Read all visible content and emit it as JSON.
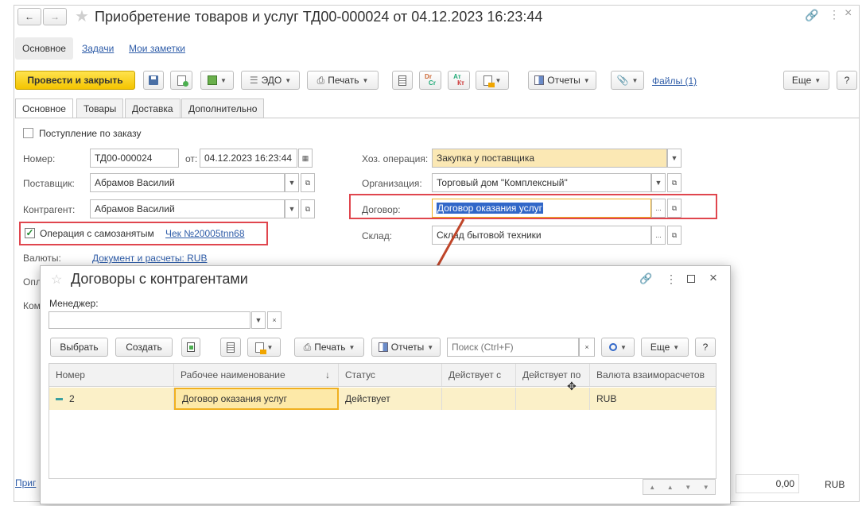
{
  "window": {
    "title": "Приобретение товаров и услуг ТД00-000024 от 04.12.2023 16:23:44",
    "more_glyph": "⋮",
    "close_glyph": "×"
  },
  "top_tabs": [
    "Основное",
    "Задачи",
    "Мои заметки"
  ],
  "toolbar": {
    "post_close": "Провести и закрыть",
    "edo": "ЭДО",
    "print": "Печать",
    "reports": "Отчеты",
    "files": "Файлы (1)",
    "more": "Еще",
    "help": "?",
    "dt_kt_top": "Dr",
    "dt_kt_bottom": "Cr",
    "at_top": "Ат",
    "at_bottom": "Кт"
  },
  "form_tabs": [
    "Основное",
    "Товары",
    "Доставка",
    "Дополнительно"
  ],
  "form": {
    "by_order_label": "Поступление по заказу",
    "number_label": "Номер:",
    "number_value": "ТД00-000024",
    "date_label": "от:",
    "date_value": "04.12.2023 16:23:44",
    "supplier_label": "Поставщик:",
    "supplier_value": "Абрамов Василий",
    "counterparty_label": "Контрагент:",
    "counterparty_value": "Абрамов Василий",
    "selfemployed_label": "Операция с самозанятым",
    "receipt_link": "Чек №20005tnn68",
    "currency_label": "Валюты:",
    "currency_link": "Документ и расчеты: RUB",
    "partial_label_1": "Опл",
    "partial_label_2": "Ком",
    "operation_label": "Хоз. операция:",
    "operation_value": "Закупка у поставщика",
    "org_label": "Организация:",
    "org_value": "Торговый дом \"Комплексный\"",
    "contract_label": "Договор:",
    "contract_value": "Договор оказания услуг",
    "warehouse_label": "Склад:",
    "warehouse_value": "Склад бытовой техники",
    "footer_link": "Приг",
    "total": "0,00",
    "total_currency": "RUB"
  },
  "modal": {
    "title": "Договоры с контрагентами",
    "manager_label": "Менеджер:",
    "manager_value": "",
    "select": "Выбрать",
    "create": "Создать",
    "print": "Печать",
    "reports": "Отчеты",
    "search_placeholder": "Поиск (Ctrl+F)",
    "more": "Еще",
    "help": "?",
    "columns": [
      "Номер",
      "Рабочее наименование",
      "Статус",
      "Действует с",
      "Действует по",
      "Валюта взаиморасчетов"
    ],
    "sort_arrow": "↓",
    "rows": [
      {
        "number": "2",
        "name": "Договор оказания услуг",
        "status": "Действует",
        "from": "",
        "to": "",
        "currency": "RUB"
      }
    ]
  },
  "colors": {
    "accent_yellow": "#f4c400",
    "highlight_red": "#e0464e",
    "link_blue": "#2e5ca8",
    "arrow": "#c0462a",
    "row_selected": "#fbf0c8"
  }
}
